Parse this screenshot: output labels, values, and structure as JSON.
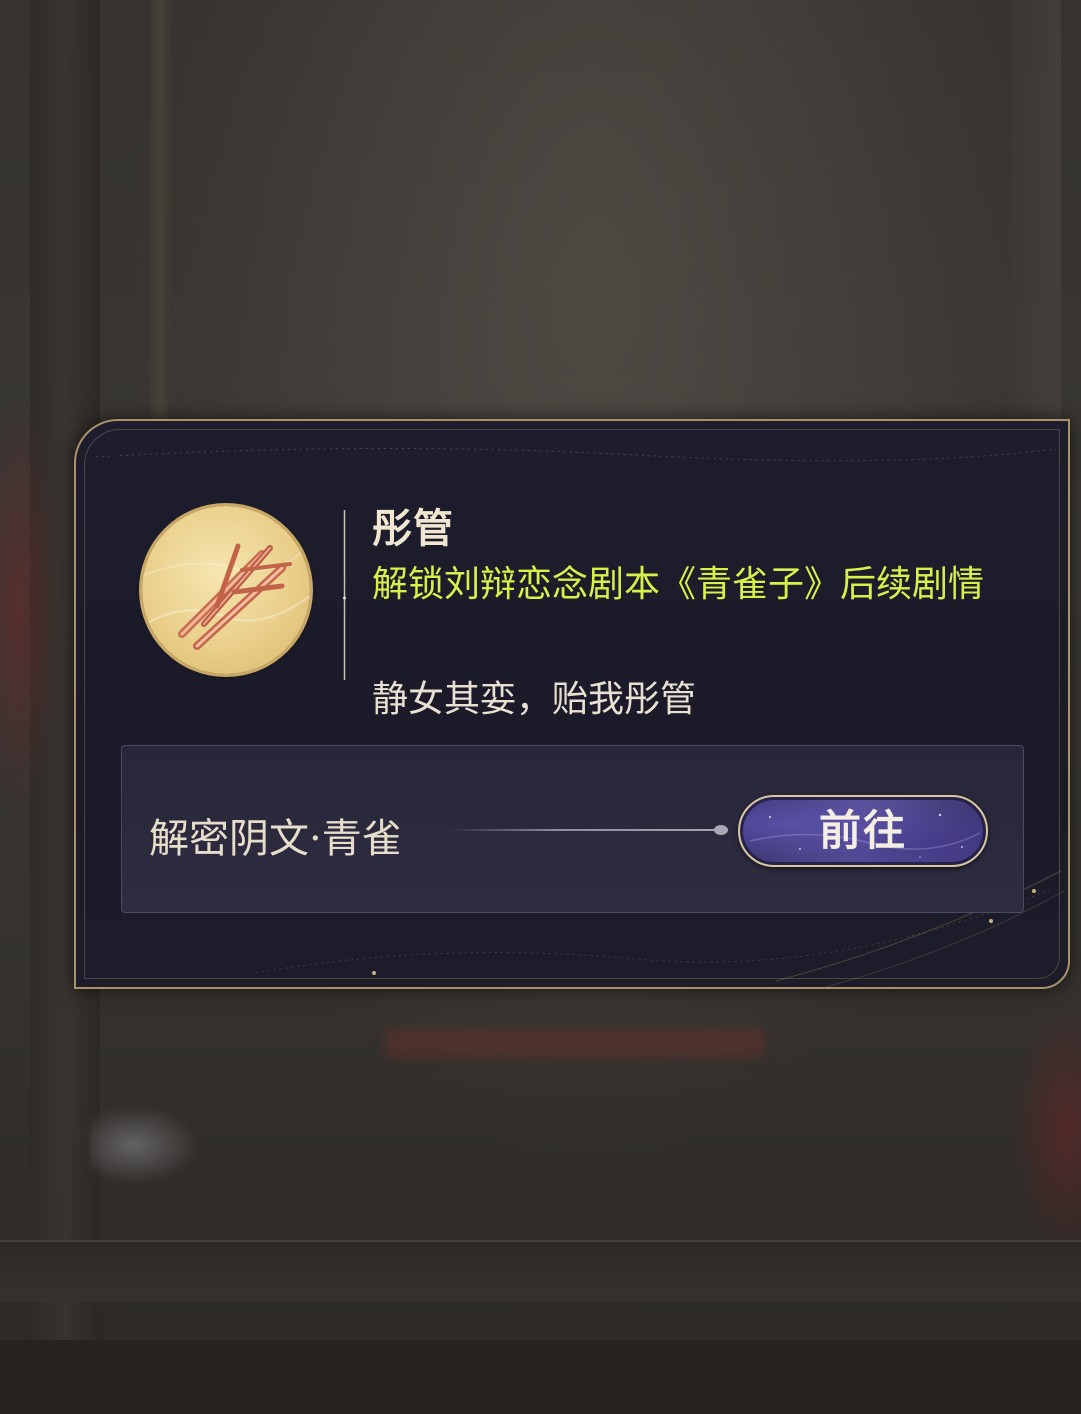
{
  "item": {
    "name": "彤管",
    "effect": "解锁刘辩恋念剧本《青雀子》后续剧情",
    "flavor": "静女其娈，贻我彤管",
    "icon": "red-brush-sticks-icon"
  },
  "source": {
    "label": "解密阴文·青雀",
    "button_label": "前往"
  },
  "colors": {
    "panel_bg": "#1d1c2b",
    "border_gold": "#a8926a",
    "effect_text": "#d9f04a",
    "button_purple": "#4b458a"
  }
}
